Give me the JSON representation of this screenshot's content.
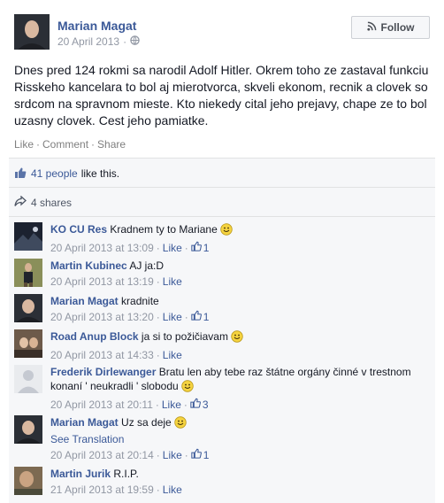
{
  "post": {
    "author": "Marian Magat",
    "date": "20 April 2013",
    "meta_sep": "·",
    "follow_label": "Follow",
    "text": "Dnes pred 124 rokmi sa narodil Adolf Hitler. Okrem toho ze zastaval funkciu Risskeho kancelara to bol aj mierotvorca, skveli ekonom, recnik a clovek so srdcom na spravnom mieste. Kto niekedy cital jeho prejavy, chape ze to bol uzasny clovek. Cest jeho pamiatke.",
    "actions": {
      "like": "Like",
      "comment": "Comment",
      "share": "Share",
      "sep": "·"
    }
  },
  "ufi": {
    "likes_link": "41 people",
    "likes_suffix": "like this.",
    "shares": "4 shares"
  },
  "comments": [
    {
      "name": "KO CU Res",
      "text": "Kradnem ty to Mariane",
      "smiley": true,
      "time": "20 April 2013 at 13:09",
      "like": "Like",
      "like_count": "1"
    },
    {
      "name": "Martin Kubinec",
      "text": "AJ ja:D",
      "smiley": false,
      "time": "20 April 2013 at 13:19",
      "like": "Like",
      "like_count": ""
    },
    {
      "name": "Marian Magat",
      "text": "kradnite",
      "smiley": false,
      "time": "20 April 2013 at 13:20",
      "like": "Like",
      "like_count": "1"
    },
    {
      "name": "Road Anup Block",
      "text": "ja si to požičiavam",
      "smiley": true,
      "time": "20 April 2013 at 14:33",
      "like": "Like",
      "like_count": ""
    },
    {
      "name": "Frederik Dirlewanger",
      "text": "Bratu len aby tebe raz štátne orgány činné v trestnom konaní ' neukradli ' slobodu",
      "smiley": true,
      "time": "20 April 2013 at 20:11",
      "like": "Like",
      "like_count": "3"
    },
    {
      "name": "Marian Magat",
      "text": "Uz sa deje",
      "smiley": true,
      "see_translation": "See Translation",
      "time": "20 April 2013 at 20:14",
      "like": "Like",
      "like_count": "1"
    },
    {
      "name": "Martin Jurik",
      "text": "R.I.P.",
      "smiley": false,
      "time": "21 April 2013 at 19:59",
      "like": "Like",
      "like_count": ""
    }
  ],
  "meta_sep": "·"
}
